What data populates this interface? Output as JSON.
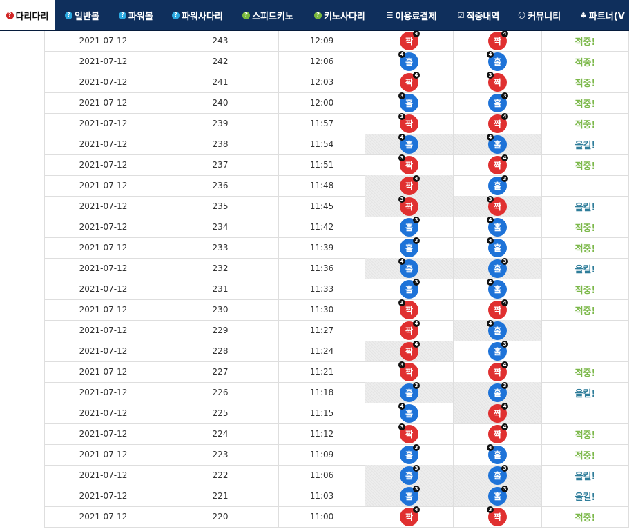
{
  "nav": {
    "items": [
      {
        "label": "다리다리",
        "icon": "question-red-icon",
        "active": true
      },
      {
        "label": "일반볼",
        "icon": "question-cyan-icon"
      },
      {
        "label": "파워볼",
        "icon": "question-cyan-icon"
      },
      {
        "label": "파워사다리",
        "icon": "question-cyan-icon"
      },
      {
        "label": "스피드키노",
        "icon": "question-green-icon"
      },
      {
        "label": "키노사다리",
        "icon": "question-green-icon"
      },
      {
        "label": "이용료결제",
        "icon": "coins-icon"
      },
      {
        "label": "적중내역",
        "icon": "checkbox-icon"
      },
      {
        "label": "커뮤니티",
        "icon": "smile-icon"
      },
      {
        "label": "파트너(V",
        "icon": "group-icon"
      }
    ]
  },
  "labels": {
    "odd": "홀",
    "even": "짝",
    "hit": "적중!",
    "all_kill": "올킬!"
  },
  "colors": {
    "nav_bg": "#0f2f5c",
    "odd": "#1e73d8",
    "even": "#e03030",
    "hit": "#7cb84a",
    "all_kill": "#2f7d9a"
  },
  "rows": [
    {
      "date": "2021-07-12",
      "round": "243",
      "time": "12:09",
      "p1": {
        "v": "짝",
        "n": "4",
        "s": "r"
      },
      "p2": {
        "v": "짝",
        "n": "4",
        "s": "r"
      },
      "result": "적중!",
      "shade": [
        0,
        0
      ]
    },
    {
      "date": "2021-07-12",
      "round": "242",
      "time": "12:06",
      "p1": {
        "v": "홀",
        "n": "4",
        "s": "l"
      },
      "p2": {
        "v": "홀",
        "n": "4",
        "s": "l"
      },
      "result": "적중!",
      "shade": [
        0,
        0
      ]
    },
    {
      "date": "2021-07-12",
      "round": "241",
      "time": "12:03",
      "p1": {
        "v": "짝",
        "n": "4",
        "s": "r"
      },
      "p2": {
        "v": "짝",
        "n": "3",
        "s": "l"
      },
      "result": "적중!",
      "shade": [
        0,
        0
      ]
    },
    {
      "date": "2021-07-12",
      "round": "240",
      "time": "12:00",
      "p1": {
        "v": "홀",
        "n": "3",
        "s": "l"
      },
      "p2": {
        "v": "홀",
        "n": "3",
        "s": "r"
      },
      "result": "적중!",
      "shade": [
        0,
        0
      ]
    },
    {
      "date": "2021-07-12",
      "round": "239",
      "time": "11:57",
      "p1": {
        "v": "짝",
        "n": "3",
        "s": "l"
      },
      "p2": {
        "v": "짝",
        "n": "4",
        "s": "r"
      },
      "result": "적중!",
      "shade": [
        0,
        0
      ]
    },
    {
      "date": "2021-07-12",
      "round": "238",
      "time": "11:54",
      "p1": {
        "v": "홀",
        "n": "4",
        "s": "l"
      },
      "p2": {
        "v": "홀",
        "n": "4",
        "s": "l"
      },
      "result": "올킬!",
      "shade": [
        1,
        1
      ]
    },
    {
      "date": "2021-07-12",
      "round": "237",
      "time": "11:51",
      "p1": {
        "v": "짝",
        "n": "3",
        "s": "l"
      },
      "p2": {
        "v": "짝",
        "n": "4",
        "s": "r"
      },
      "result": "적중!",
      "shade": [
        0,
        0
      ]
    },
    {
      "date": "2021-07-12",
      "round": "236",
      "time": "11:48",
      "p1": {
        "v": "짝",
        "n": "4",
        "s": "r"
      },
      "p2": {
        "v": "홀",
        "n": "3",
        "s": "r"
      },
      "result": "",
      "shade": [
        1,
        0
      ]
    },
    {
      "date": "2021-07-12",
      "round": "235",
      "time": "11:45",
      "p1": {
        "v": "짝",
        "n": "3",
        "s": "l"
      },
      "p2": {
        "v": "짝",
        "n": "3",
        "s": "l"
      },
      "result": "올킬!",
      "shade": [
        1,
        1
      ]
    },
    {
      "date": "2021-07-12",
      "round": "234",
      "time": "11:42",
      "p1": {
        "v": "홀",
        "n": "3",
        "s": "r"
      },
      "p2": {
        "v": "홀",
        "n": "4",
        "s": "l"
      },
      "result": "적중!",
      "shade": [
        0,
        0
      ]
    },
    {
      "date": "2021-07-12",
      "round": "233",
      "time": "11:39",
      "p1": {
        "v": "홀",
        "n": "3",
        "s": "r"
      },
      "p2": {
        "v": "홀",
        "n": "4",
        "s": "l"
      },
      "result": "적중!",
      "shade": [
        0,
        0
      ]
    },
    {
      "date": "2021-07-12",
      "round": "232",
      "time": "11:36",
      "p1": {
        "v": "홀",
        "n": "4",
        "s": "l"
      },
      "p2": {
        "v": "홀",
        "n": "3",
        "s": "r"
      },
      "result": "올킬!",
      "shade": [
        1,
        1
      ]
    },
    {
      "date": "2021-07-12",
      "round": "231",
      "time": "11:33",
      "p1": {
        "v": "홀",
        "n": "3",
        "s": "r"
      },
      "p2": {
        "v": "홀",
        "n": "4",
        "s": "l"
      },
      "result": "적중!",
      "shade": [
        0,
        0
      ]
    },
    {
      "date": "2021-07-12",
      "round": "230",
      "time": "11:30",
      "p1": {
        "v": "짝",
        "n": "3",
        "s": "l"
      },
      "p2": {
        "v": "짝",
        "n": "4",
        "s": "r"
      },
      "result": "적중!",
      "shade": [
        0,
        0
      ]
    },
    {
      "date": "2021-07-12",
      "round": "229",
      "time": "11:27",
      "p1": {
        "v": "짝",
        "n": "4",
        "s": "r"
      },
      "p2": {
        "v": "홀",
        "n": "4",
        "s": "l"
      },
      "result": "",
      "shade": [
        0,
        1
      ]
    },
    {
      "date": "2021-07-12",
      "round": "228",
      "time": "11:24",
      "p1": {
        "v": "짝",
        "n": "4",
        "s": "r"
      },
      "p2": {
        "v": "홀",
        "n": "3",
        "s": "r"
      },
      "result": "",
      "shade": [
        1,
        0
      ]
    },
    {
      "date": "2021-07-12",
      "round": "227",
      "time": "11:21",
      "p1": {
        "v": "짝",
        "n": "3",
        "s": "l"
      },
      "p2": {
        "v": "짝",
        "n": "4",
        "s": "r"
      },
      "result": "적중!",
      "shade": [
        0,
        0
      ]
    },
    {
      "date": "2021-07-12",
      "round": "226",
      "time": "11:18",
      "p1": {
        "v": "홀",
        "n": "3",
        "s": "r"
      },
      "p2": {
        "v": "홀",
        "n": "3",
        "s": "r"
      },
      "result": "올킬!",
      "shade": [
        1,
        1
      ]
    },
    {
      "date": "2021-07-12",
      "round": "225",
      "time": "11:15",
      "p1": {
        "v": "홀",
        "n": "4",
        "s": "l"
      },
      "p2": {
        "v": "짝",
        "n": "4",
        "s": "r"
      },
      "result": "",
      "shade": [
        0,
        1
      ]
    },
    {
      "date": "2021-07-12",
      "round": "224",
      "time": "11:12",
      "p1": {
        "v": "짝",
        "n": "3",
        "s": "l"
      },
      "p2": {
        "v": "짝",
        "n": "4",
        "s": "r"
      },
      "result": "적중!",
      "shade": [
        0,
        0
      ]
    },
    {
      "date": "2021-07-12",
      "round": "223",
      "time": "11:09",
      "p1": {
        "v": "홀",
        "n": "3",
        "s": "r"
      },
      "p2": {
        "v": "홀",
        "n": "4",
        "s": "l"
      },
      "result": "적중!",
      "shade": [
        0,
        0
      ]
    },
    {
      "date": "2021-07-12",
      "round": "222",
      "time": "11:06",
      "p1": {
        "v": "홀",
        "n": "3",
        "s": "r"
      },
      "p2": {
        "v": "홀",
        "n": "3",
        "s": "r"
      },
      "result": "올킬!",
      "shade": [
        1,
        1
      ]
    },
    {
      "date": "2021-07-12",
      "round": "221",
      "time": "11:03",
      "p1": {
        "v": "홀",
        "n": "3",
        "s": "r"
      },
      "p2": {
        "v": "홀",
        "n": "3",
        "s": "r"
      },
      "result": "올킬!",
      "shade": [
        1,
        1
      ]
    },
    {
      "date": "2021-07-12",
      "round": "220",
      "time": "11:00",
      "p1": {
        "v": "짝",
        "n": "4",
        "s": "r"
      },
      "p2": {
        "v": "짝",
        "n": "3",
        "s": "l"
      },
      "result": "적중!",
      "shade": [
        0,
        0
      ]
    }
  ]
}
